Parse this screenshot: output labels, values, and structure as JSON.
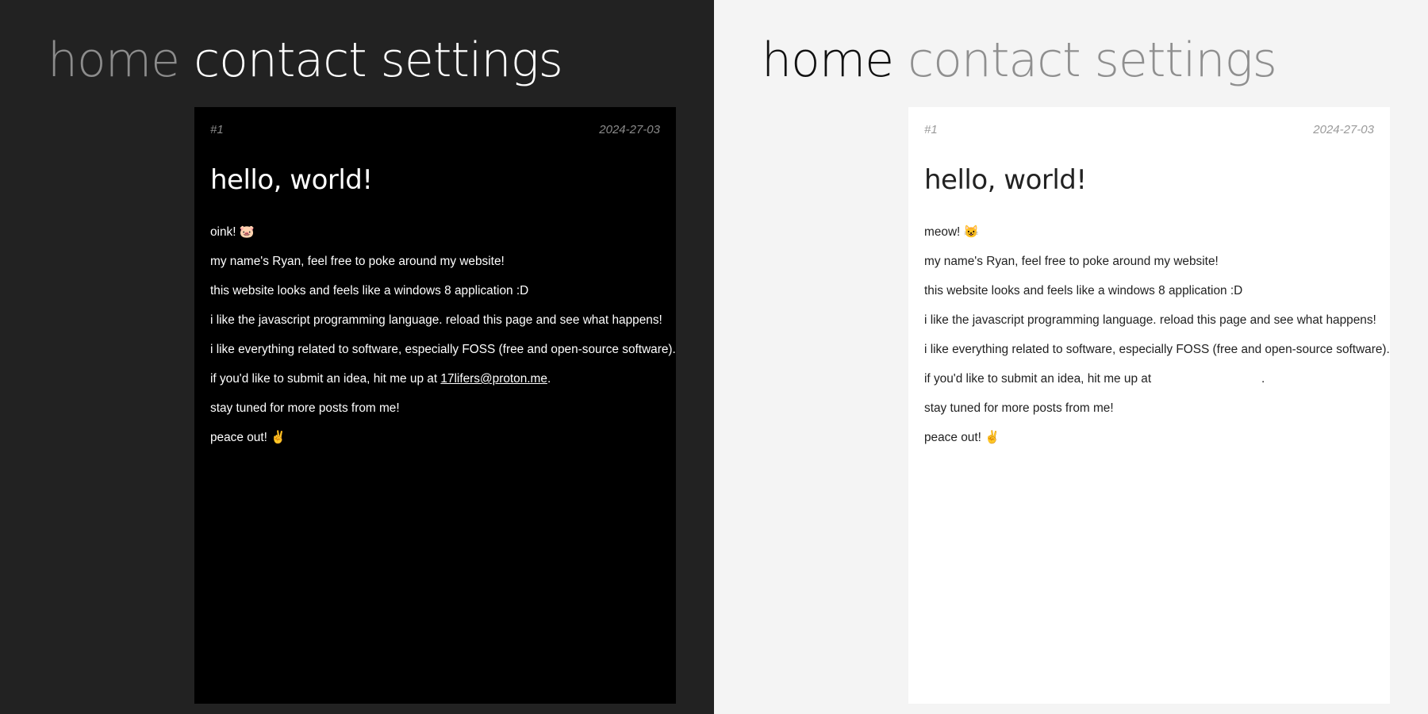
{
  "nav": {
    "home": "home",
    "contact": "contact",
    "settings": "settings"
  },
  "post": {
    "number": "#1",
    "date": "2024-27-03",
    "title": "hello, world!",
    "email": "17lifers@proton.me",
    "lines": {
      "intro_dark": "oink! 🐷",
      "intro_light": "meow! 😺",
      "name": "my name's Ryan, feel free to poke around my website!",
      "windows": "this website looks and feels like a windows 8 application :D",
      "javascript": "i like the javascript programming language. reload this page and see what happens!",
      "foss": "i like everything related to software, especially FOSS (free and open-source software).",
      "idea_prefix": "if you'd like to submit an idea, hit me up at ",
      "idea_suffix": ".",
      "stay_tuned": "stay tuned for more posts from me!",
      "peace": "peace out! ✌️"
    }
  },
  "colors": {
    "dark_bg": "#222222",
    "dark_card": "#000000",
    "light_bg": "#f4f4f4",
    "light_card": "#ffffff"
  }
}
